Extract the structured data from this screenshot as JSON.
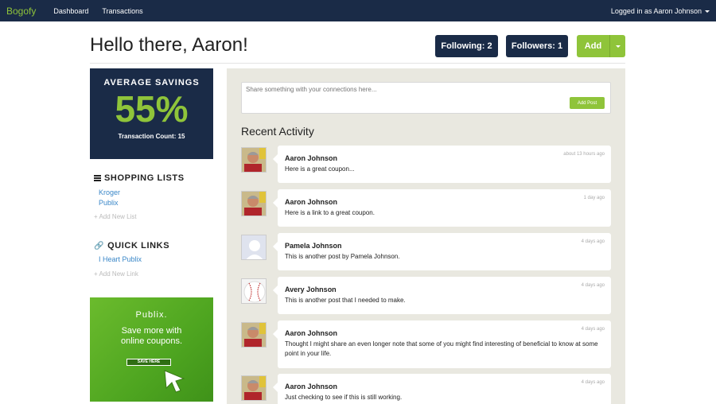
{
  "nav": {
    "brand": "Bogofy",
    "links": [
      "Dashboard",
      "Transactions"
    ],
    "user": "Logged in as Aaron Johnson"
  },
  "header": {
    "greeting": "Hello there, Aaron!",
    "following": "Following: 2",
    "followers": "Followers: 1",
    "add": "Add"
  },
  "savings": {
    "title": "AVERAGE SAVINGS",
    "value": "55%",
    "count": "Transaction Count: 15"
  },
  "shopping_lists": {
    "title": "SHOPPING LISTS",
    "items": [
      "Kroger",
      "Publix"
    ],
    "add": "Add New List"
  },
  "quick_links": {
    "title": "QUICK LINKS",
    "items": [
      "I Heart Publix"
    ],
    "add": "Add New Link"
  },
  "ad": {
    "brand": "Publix.",
    "line1": "Save more with",
    "line2": "online coupons.",
    "button": "SAVE HERE"
  },
  "share": {
    "placeholder": "Share something with your connections here...",
    "button": "Add Post"
  },
  "recent": {
    "title": "Recent Activity",
    "posts": [
      {
        "author": "Aaron Johnson",
        "text": "Here is a great coupon...",
        "time": "about 13 hours ago",
        "avatar": "man-photo"
      },
      {
        "author": "Aaron Johnson",
        "text": "Here is a link to a great coupon.",
        "time": "1 day ago",
        "avatar": "man-photo"
      },
      {
        "author": "Pamela Johnson",
        "text": "This is another post by Pamela Johnson.",
        "time": "4 days ago",
        "avatar": "default-silhouette"
      },
      {
        "author": "Avery Johnson",
        "text": "This is another post that I needed to make.",
        "time": "4 days ago",
        "avatar": "baseball"
      },
      {
        "author": "Aaron Johnson",
        "text": "Thought I might share an even longer note that some of you might find interesting of beneficial to know at some point in your life.",
        "time": "4 days ago",
        "avatar": "man-photo"
      },
      {
        "author": "Aaron Johnson",
        "text": "Just checking to see if this is still working.",
        "time": "4 days ago",
        "avatar": "man-photo"
      }
    ]
  },
  "colors": {
    "navy": "#1a2b47",
    "green": "#8fc43a",
    "link": "#3a87c8",
    "feed_bg": "#e9e8e0"
  }
}
